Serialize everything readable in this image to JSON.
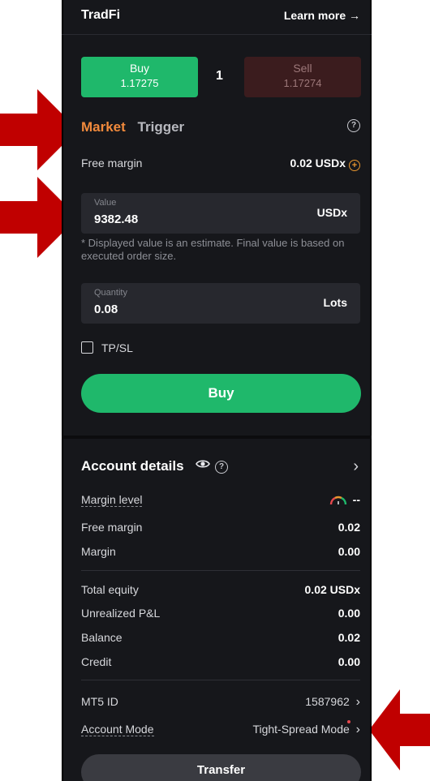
{
  "header": {
    "title": "TradFi",
    "learn_more": "Learn more →"
  },
  "quote": {
    "buy_label": "Buy",
    "buy_price": "1.17275",
    "spread": "1",
    "sell_label": "Sell",
    "sell_price": "1.17274"
  },
  "order_tabs": {
    "market": "Market",
    "trigger": "Trigger",
    "help_icon": "?"
  },
  "free_margin": {
    "label": "Free margin",
    "value": "0.02 USDx",
    "add_icon": "+"
  },
  "value_field": {
    "label": "Value",
    "value": "9382.48",
    "unit": "USDx"
  },
  "estimate_note": "* Displayed value is an estimate. Final value is based on executed order size.",
  "quantity_field": {
    "label": "Quantity",
    "value": "0.08",
    "unit": "Lots"
  },
  "tpsl": {
    "label": "TP/SL"
  },
  "buy_button": {
    "label": "Buy"
  },
  "account": {
    "title": "Account details",
    "help_icon": "?",
    "chevron": "›",
    "margin_level": {
      "label": "Margin level",
      "value": "--"
    },
    "free_margin": {
      "label": "Free margin",
      "value": "0.02"
    },
    "margin": {
      "label": "Margin",
      "value": "0.00"
    },
    "total_equity": {
      "label": "Total equity",
      "value": "0.02 USDx"
    },
    "unrealized_pnl": {
      "label": "Unrealized P&L",
      "value": "0.00"
    },
    "balance": {
      "label": "Balance",
      "value": "0.02"
    },
    "credit": {
      "label": "Credit",
      "value": "0.00"
    },
    "mt5_id": {
      "label": "MT5 ID",
      "value": "1587962",
      "chevron": "›"
    },
    "account_mode": {
      "label": "Account Mode",
      "value": "Tight-Spread Mode",
      "chevron": "›"
    }
  },
  "transfer_button": {
    "label": "Transfer"
  },
  "colors": {
    "accent_green": "#1fb86b",
    "accent_orange": "#f18a3c",
    "annotation_red": "#c00000",
    "panel_bg": "#16171b"
  }
}
